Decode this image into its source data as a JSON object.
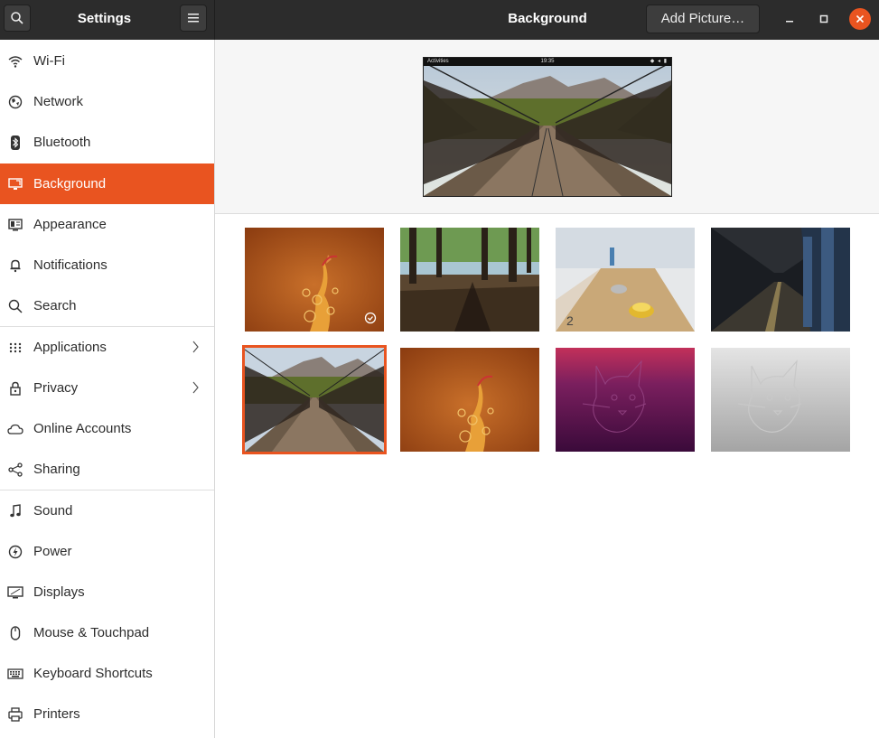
{
  "header": {
    "settings_title": "Settings",
    "page_title": "Background",
    "add_picture_label": "Add Picture…"
  },
  "sidebar": {
    "items": [
      {
        "label": "Wi-Fi",
        "icon": "wifi-icon"
      },
      {
        "label": "Network",
        "icon": "network-icon"
      },
      {
        "label": "Bluetooth",
        "icon": "bluetooth-icon"
      },
      {
        "label": "Background",
        "icon": "background-icon",
        "active": true
      },
      {
        "label": "Appearance",
        "icon": "appearance-icon"
      },
      {
        "label": "Notifications",
        "icon": "bell-icon"
      },
      {
        "label": "Search",
        "icon": "search-icon"
      },
      {
        "label": "Applications",
        "icon": "grid-icon",
        "submenu": true
      },
      {
        "label": "Privacy",
        "icon": "lock-icon",
        "submenu": true
      },
      {
        "label": "Online Accounts",
        "icon": "cloud-icon"
      },
      {
        "label": "Sharing",
        "icon": "share-icon"
      },
      {
        "label": "Sound",
        "icon": "music-note-icon"
      },
      {
        "label": "Power",
        "icon": "power-icon"
      },
      {
        "label": "Displays",
        "icon": "display-icon"
      },
      {
        "label": "Mouse & Touchpad",
        "icon": "mouse-icon"
      },
      {
        "label": "Keyboard Shortcuts",
        "icon": "keyboard-icon"
      },
      {
        "label": "Printers",
        "icon": "printer-icon"
      }
    ]
  },
  "preview": {
    "activities_label": "Activities",
    "clock": "19:35"
  },
  "wallpapers": [
    {
      "name": "orange-bird",
      "current": true
    },
    {
      "name": "forest-lake"
    },
    {
      "name": "shuffleboard"
    },
    {
      "name": "subway-station"
    },
    {
      "name": "bridge",
      "selected": true
    },
    {
      "name": "orange-bird-alt"
    },
    {
      "name": "purple-cat"
    },
    {
      "name": "grey-cat"
    }
  ],
  "colors": {
    "accent": "#e95420",
    "headerbar": "#2c2c2c"
  }
}
